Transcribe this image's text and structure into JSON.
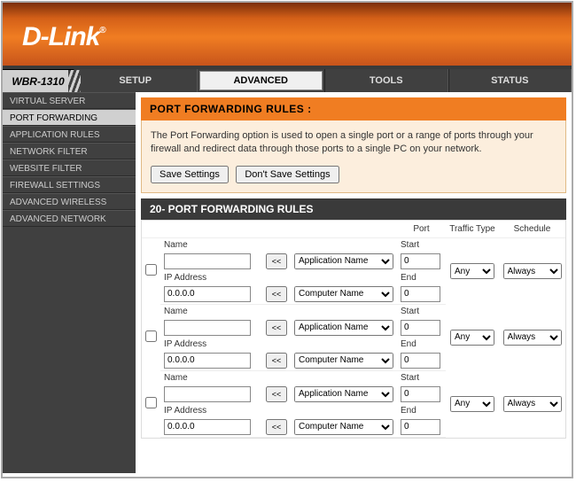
{
  "brand": "D-Link",
  "model": "WBR-1310",
  "tabs": [
    {
      "label": "SETUP"
    },
    {
      "label": "ADVANCED"
    },
    {
      "label": "TOOLS"
    },
    {
      "label": "STATUS"
    }
  ],
  "active_tab": 1,
  "sidebar": [
    {
      "label": "VIRTUAL SERVER"
    },
    {
      "label": "PORT FORWARDING"
    },
    {
      "label": "APPLICATION RULES"
    },
    {
      "label": "NETWORK FILTER"
    },
    {
      "label": "WEBSITE FILTER"
    },
    {
      "label": "FIREWALL SETTINGS"
    },
    {
      "label": "ADVANCED WIRELESS"
    },
    {
      "label": "ADVANCED NETWORK"
    }
  ],
  "active_side": 1,
  "section": {
    "title": "PORT FORWARDING RULES :",
    "description": "The Port Forwarding option is used to open a single port or a range of ports through your firewall and redirect data through those ports to a single PC on your network.",
    "save_btn": "Save Settings",
    "dont_save_btn": "Don't Save Settings"
  },
  "rules_table": {
    "title": "20- PORT FORWARDING RULES",
    "cols": {
      "port": "Port",
      "traffic": "Traffic Type",
      "schedule": "Schedule"
    },
    "labels": {
      "name": "Name",
      "ip": "IP Address",
      "start": "Start",
      "end": "End"
    },
    "copy_btn": "<<",
    "app_name": "Application Name",
    "comp_name": "Computer Name",
    "traffic_opt": "Any",
    "schedule_opt": "Always",
    "rows": [
      {
        "name": "",
        "ip": "0.0.0.0",
        "start": "0",
        "end": "0"
      },
      {
        "name": "",
        "ip": "0.0.0.0",
        "start": "0",
        "end": "0"
      },
      {
        "name": "",
        "ip": "0.0.0.0",
        "start": "0",
        "end": "0"
      }
    ]
  }
}
